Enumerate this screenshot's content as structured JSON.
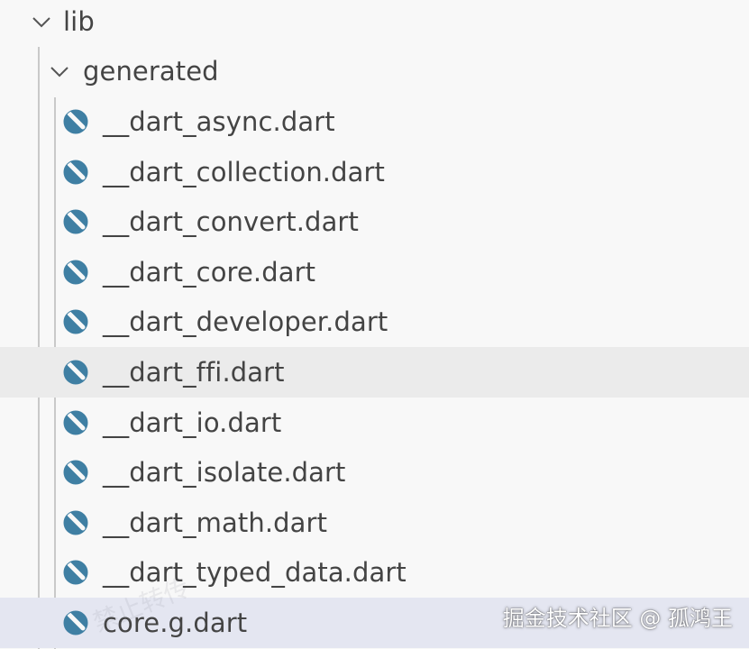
{
  "tree": {
    "root_folder": {
      "label": "lib",
      "expanded": true
    },
    "sub_folder": {
      "label": "generated",
      "expanded": true
    },
    "files": [
      {
        "label": "__dart_async.dart",
        "icon": "dart-file-icon"
      },
      {
        "label": "__dart_collection.dart",
        "icon": "dart-file-icon"
      },
      {
        "label": "__dart_convert.dart",
        "icon": "dart-file-icon"
      },
      {
        "label": "__dart_core.dart",
        "icon": "dart-file-icon"
      },
      {
        "label": "__dart_developer.dart",
        "icon": "dart-file-icon"
      },
      {
        "label": "__dart_ffi.dart",
        "icon": "dart-file-icon",
        "state": "hovered"
      },
      {
        "label": "__dart_io.dart",
        "icon": "dart-file-icon"
      },
      {
        "label": "__dart_isolate.dart",
        "icon": "dart-file-icon"
      },
      {
        "label": "__dart_math.dart",
        "icon": "dart-file-icon"
      },
      {
        "label": "__dart_typed_data.dart",
        "icon": "dart-file-icon"
      },
      {
        "label": "core.g.dart",
        "icon": "dart-file-icon",
        "state": "selected"
      }
    ]
  },
  "watermark": {
    "text": "掘金技术社区 @ 孤鸿王"
  },
  "colors": {
    "background": "#f8f8f8",
    "hover_row": "#ebebeb",
    "selected_row": "#e4e6f1",
    "text": "#444444",
    "dart_icon": "#3f7fa3"
  }
}
